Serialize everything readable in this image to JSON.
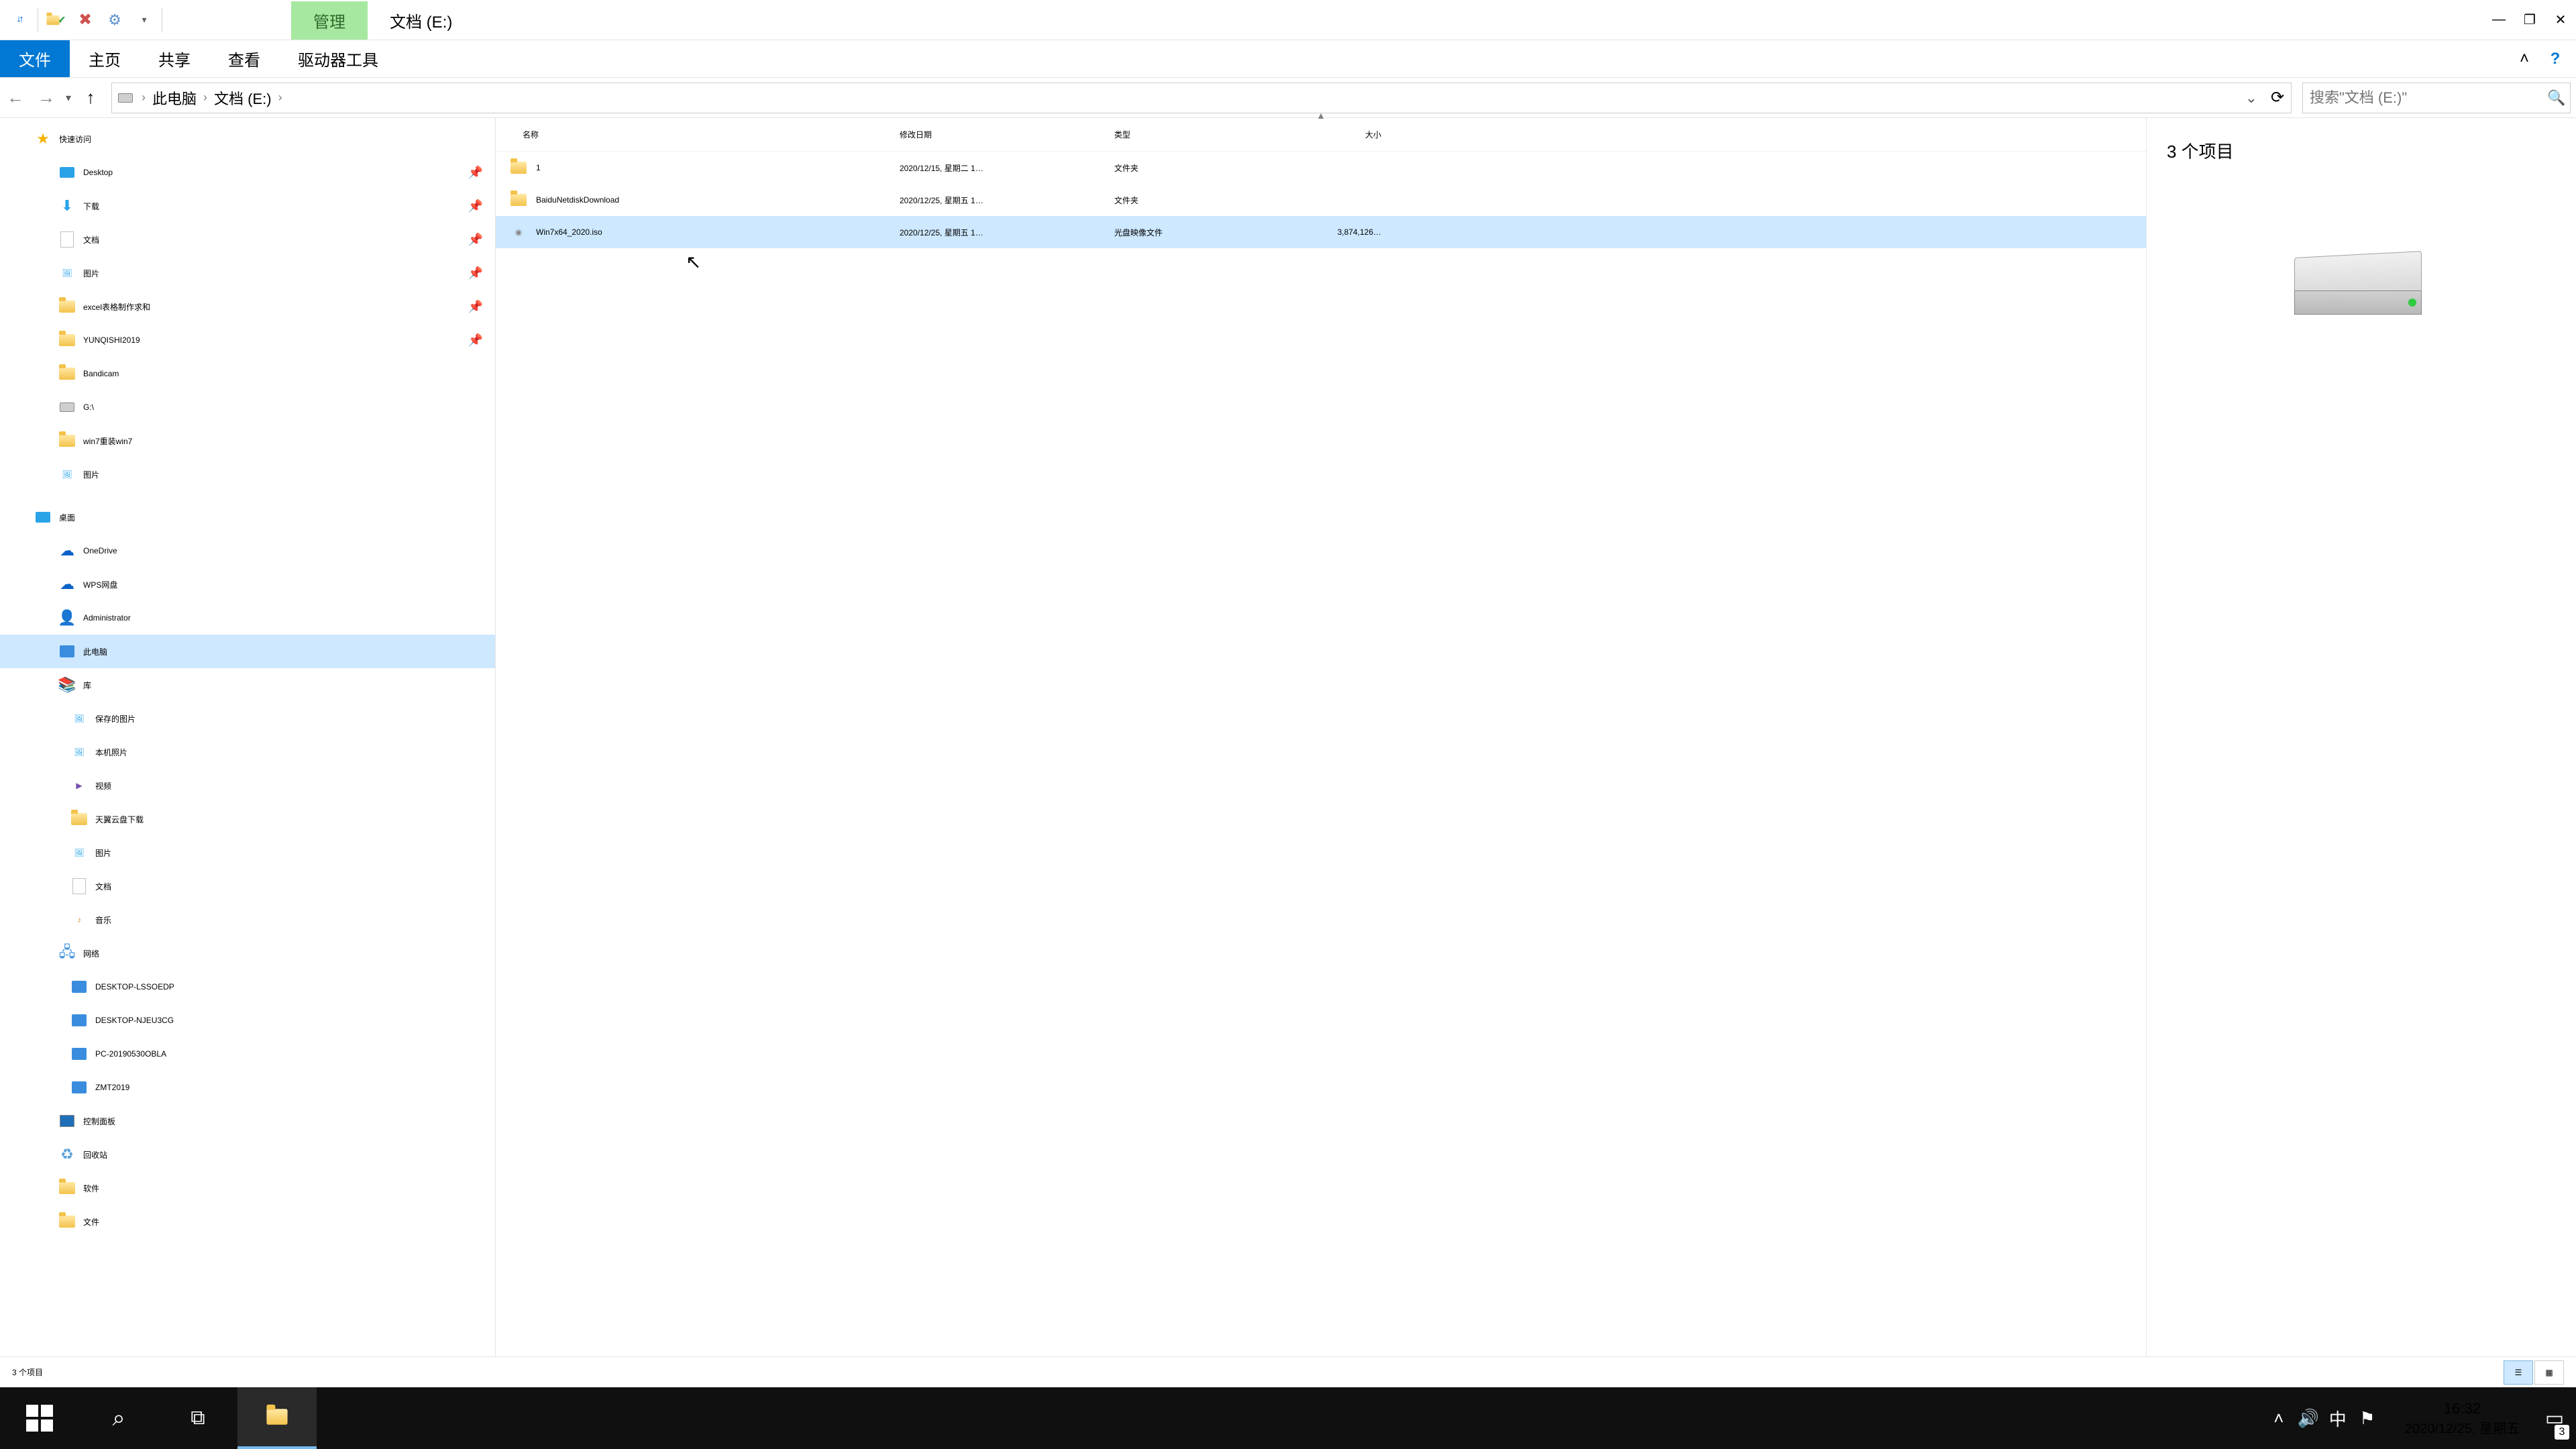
{
  "titlebar": {
    "contextual_tab": "管理",
    "window_title": "文档 (E:)"
  },
  "ribbon": {
    "file": "文件",
    "home": "主页",
    "share": "共享",
    "view": "查看",
    "drive_tools": "驱动器工具"
  },
  "nav": {
    "crumb_pc": "此电脑",
    "crumb_drive": "文档 (E:)",
    "search_placeholder": "搜索\"文档 (E:)\""
  },
  "columns": {
    "name": "名称",
    "date": "修改日期",
    "type": "类型",
    "size": "大小"
  },
  "files": [
    {
      "icon": "folder",
      "name": "1",
      "date": "2020/12/15, 星期二 1…",
      "type": "文件夹",
      "size": "",
      "selected": false
    },
    {
      "icon": "folder",
      "name": "BaiduNetdiskDownload",
      "date": "2020/12/25, 星期五 1…",
      "type": "文件夹",
      "size": "",
      "selected": false
    },
    {
      "icon": "disc",
      "name": "Win7x64_2020.iso",
      "date": "2020/12/25, 星期五 1…",
      "type": "光盘映像文件",
      "size": "3,874,126…",
      "selected": true
    }
  ],
  "preview": {
    "title": "3 个项目"
  },
  "sidebar": {
    "quick_access": "快速访问",
    "quick_items": [
      {
        "icon": "desk",
        "label": "Desktop",
        "pin": true
      },
      {
        "icon": "dl",
        "label": "下载",
        "pin": true
      },
      {
        "icon": "doc",
        "label": "文档",
        "pin": true
      },
      {
        "icon": "pic",
        "label": "图片",
        "pin": true
      },
      {
        "icon": "folder",
        "label": "excel表格制作求和",
        "pin": true
      },
      {
        "icon": "folder",
        "label": "YUNQISHI2019",
        "pin": true
      },
      {
        "icon": "folder",
        "label": "Bandicam",
        "pin": false
      },
      {
        "icon": "drive",
        "label": "G:\\",
        "pin": false
      },
      {
        "icon": "folder",
        "label": "win7重装win7",
        "pin": false
      },
      {
        "icon": "pic",
        "label": "图片",
        "pin": false
      }
    ],
    "desktop": "桌面",
    "desktop_items": [
      {
        "icon": "onedrive",
        "label": "OneDrive"
      },
      {
        "icon": "wps",
        "label": "WPS网盘"
      },
      {
        "icon": "user",
        "label": "Administrator"
      },
      {
        "icon": "pc",
        "label": "此电脑",
        "selected": true
      },
      {
        "icon": "lib",
        "label": "库"
      }
    ],
    "library_items": [
      {
        "icon": "pic",
        "label": "保存的图片"
      },
      {
        "icon": "pic",
        "label": "本机照片"
      },
      {
        "icon": "vid",
        "label": "视频"
      },
      {
        "icon": "folder",
        "label": "天翼云盘下载"
      },
      {
        "icon": "pic",
        "label": "图片"
      },
      {
        "icon": "doc",
        "label": "文档"
      },
      {
        "icon": "music",
        "label": "音乐"
      }
    ],
    "network": "网络",
    "network_items": [
      {
        "label": "DESKTOP-LSSOEDP"
      },
      {
        "label": "DESKTOP-NJEU3CG"
      },
      {
        "label": "PC-20190530OBLA"
      },
      {
        "label": "ZMT2019"
      }
    ],
    "tail_items": [
      {
        "icon": "panel",
        "label": "控制面板"
      },
      {
        "icon": "recycle",
        "label": "回收站"
      },
      {
        "icon": "folder",
        "label": "软件"
      },
      {
        "icon": "folder",
        "label": "文件"
      }
    ]
  },
  "status": {
    "text": "3 个项目"
  },
  "taskbar": {
    "time": "16:32",
    "date": "2020/12/25, 星期五",
    "ime": "中",
    "notif_count": "3"
  }
}
